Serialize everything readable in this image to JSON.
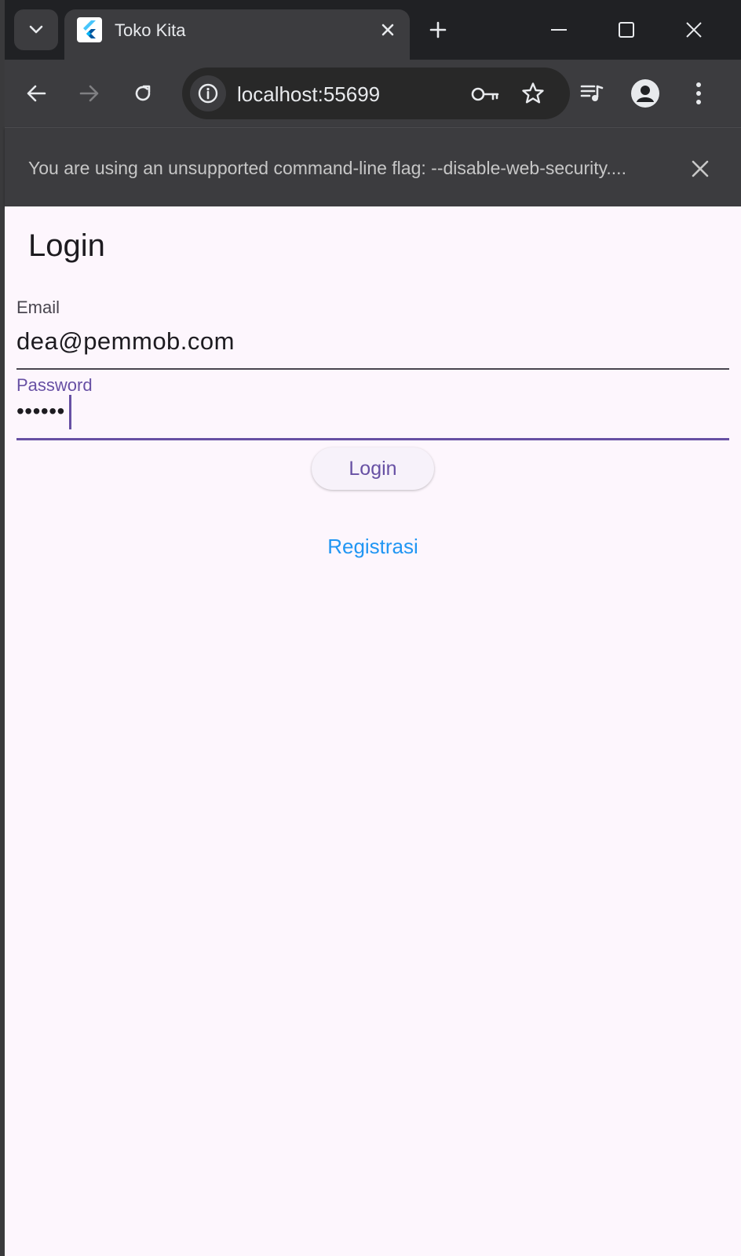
{
  "browser": {
    "tab": {
      "title": "Toko Kita"
    },
    "omnibox": {
      "url": "localhost:55699"
    },
    "infobar": {
      "message": "You are using an unsupported command-line flag: --disable-web-security...."
    }
  },
  "page": {
    "title": "Login",
    "email": {
      "label": "Email",
      "value": "dea@pemmob.com"
    },
    "password": {
      "label": "Password",
      "value": "••••••"
    },
    "login_button": "Login",
    "register_link": "Registrasi"
  },
  "colors": {
    "primary": "#6750a4",
    "link": "#2196f3",
    "page_background": "#fdf6fd",
    "chrome_dark": "#202124",
    "chrome_toolbar": "#3c3c3f"
  }
}
